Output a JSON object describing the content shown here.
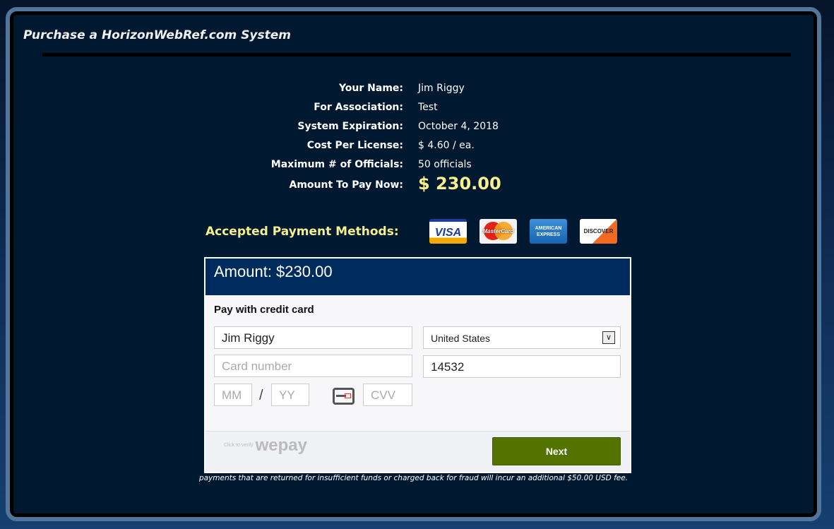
{
  "header": {
    "title": "Purchase a HorizonWebRef.com System"
  },
  "summary": [
    {
      "label": "Your Name:",
      "value": "Jim Riggy"
    },
    {
      "label": "For Association:",
      "value": "Test"
    },
    {
      "label": "System Expiration:",
      "value": "October 4, 2018"
    },
    {
      "label": "Cost Per License:",
      "value": "$ 4.60 / ea."
    },
    {
      "label": "Maximum # of Officials:",
      "value": "50 officials"
    },
    {
      "label": "Amount To Pay Now:",
      "value": "$ 230.00"
    }
  ],
  "payment_methods": {
    "label": "Accepted Payment Methods:",
    "cards": [
      "VISA",
      "MasterCard",
      "AMERICAN EXPRESS",
      "DISCOVER"
    ]
  },
  "form": {
    "amount": "Amount: $230.00",
    "heading": "Pay with credit card",
    "name": "Jim Riggy",
    "country": "United States",
    "card_placeholder": "Card number",
    "zip": "14532",
    "mm_placeholder": "MM",
    "slash": "/",
    "yy_placeholder": "YY",
    "cvv_placeholder": "CVV",
    "wepay_small": "Click to verify",
    "wepay": "wepay",
    "next": "Next"
  },
  "note": "payments that are returned for insufficient funds or charged back for fraud will incur an additional $50.00 USD fee.",
  "colors": {
    "amount": "#f8f08c",
    "header_bar": "#002c5d",
    "next_button": "#527300",
    "frame": "#52759b"
  }
}
